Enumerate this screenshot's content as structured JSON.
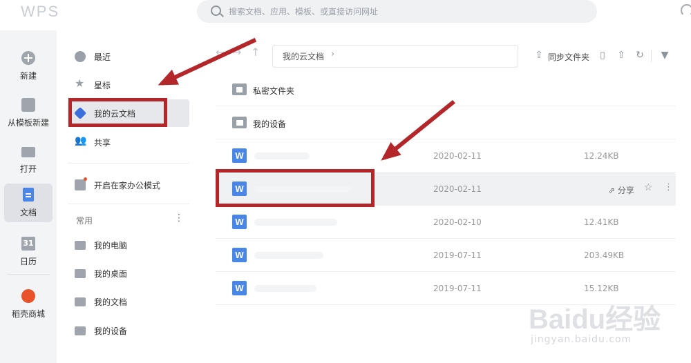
{
  "app": {
    "logo": "WPS"
  },
  "search": {
    "placeholder": "搜索文档、应用、模板、或直接访问网址"
  },
  "leftnav": {
    "items": [
      {
        "label": "新建",
        "icon": "plus-circle-icon"
      },
      {
        "label": "从模板新建",
        "icon": "template-icon"
      },
      {
        "label": "打开",
        "icon": "folder-icon"
      },
      {
        "label": "文档",
        "icon": "document-icon",
        "active": true
      },
      {
        "label": "日历",
        "icon": "calendar-icon",
        "glyph": "31"
      },
      {
        "label": "稻壳商城",
        "icon": "shop-icon"
      }
    ]
  },
  "sidebar": {
    "items": [
      {
        "label": "最近",
        "icon": "clock-icon"
      },
      {
        "label": "星标",
        "icon": "star-icon"
      },
      {
        "label": "我的云文档",
        "icon": "cloud-cube-icon",
        "active": true
      },
      {
        "label": "共享",
        "icon": "people-icon"
      },
      {
        "label": "开启在家办公模式",
        "icon": "home-office-icon"
      }
    ],
    "common_label": "常用",
    "common_items": [
      {
        "label": "我的电脑",
        "icon": "computer-icon"
      },
      {
        "label": "我的桌面",
        "icon": "desktop-icon"
      },
      {
        "label": "我的文档",
        "icon": "folder-icon"
      },
      {
        "label": "我的设备",
        "icon": "device-icon"
      }
    ]
  },
  "toolbar": {
    "path": "我的云文档",
    "sync_label": "同步文件夹"
  },
  "files": [
    {
      "name": "私密文件夹",
      "type": "folder",
      "icon": "lock-folder-icon"
    },
    {
      "name": "我的设备",
      "type": "folder",
      "icon": "device-folder-icon"
    },
    {
      "name": "",
      "type": "doc",
      "date": "2020-02-11",
      "size": "12.24KB"
    },
    {
      "name": "",
      "type": "doc",
      "date": "2020-02-11",
      "size": "",
      "share_label": "分享",
      "active": true
    },
    {
      "name": "",
      "type": "doc",
      "date": "2020-02-10",
      "size": "12.41KB"
    },
    {
      "name": "",
      "type": "doc",
      "date": "2019-07-11",
      "size": "203.49KB"
    },
    {
      "name": "",
      "type": "doc",
      "date": "2019-07-11",
      "size": "15.12KB"
    }
  ],
  "watermark": {
    "text": "Baidu经验",
    "url_text": "jingyan.baidu.com"
  },
  "colors": {
    "accent": "#4a86e8",
    "highlight": "#b3272a"
  }
}
